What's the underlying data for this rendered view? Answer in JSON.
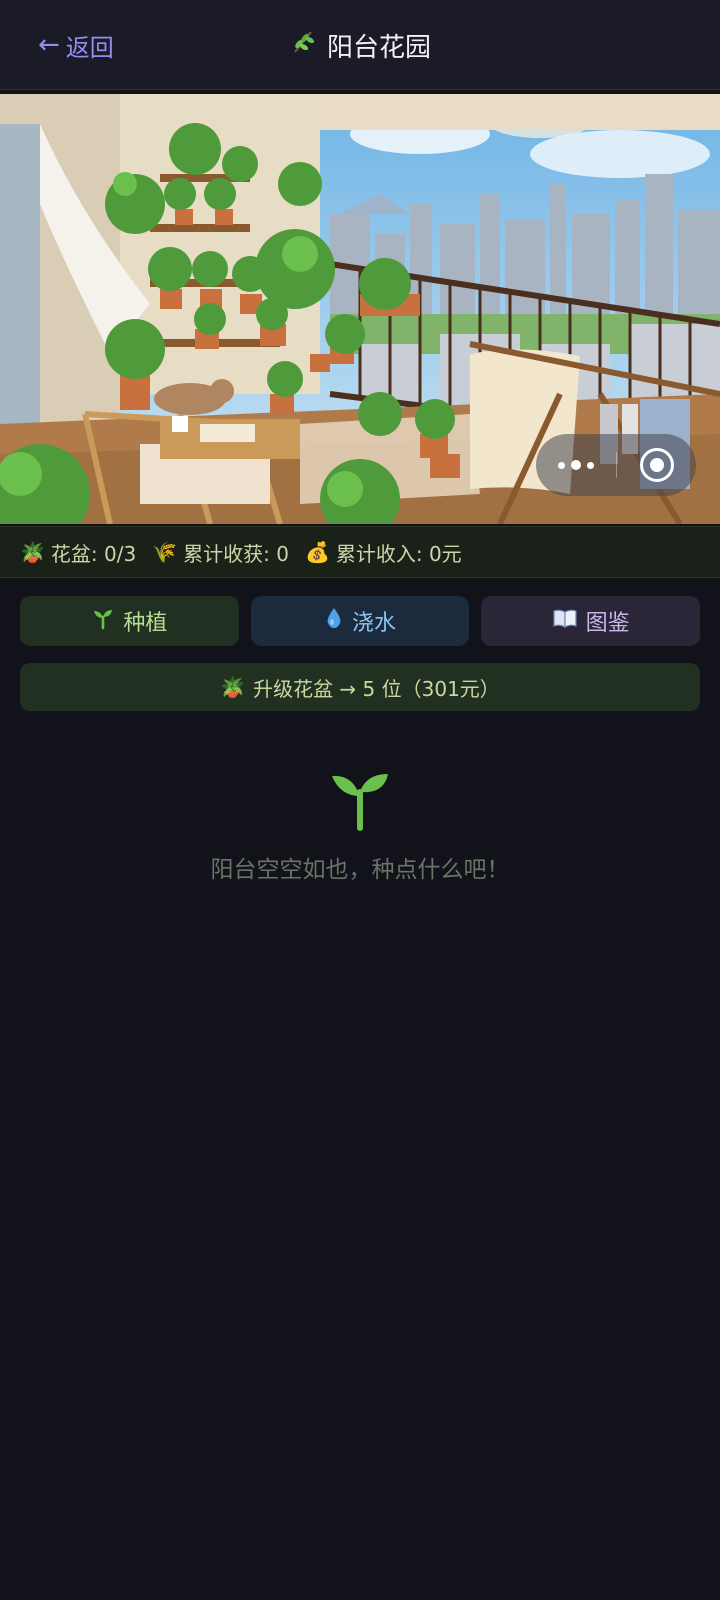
{
  "header": {
    "back_label": "返回",
    "back_icon": "left-arrow-icon",
    "title": "阳台花园",
    "title_icon": "herb-icon"
  },
  "hero": {
    "image_icon": "balcony-garden-illustration"
  },
  "capsule": {
    "more_icon": "more-dots-icon",
    "close_icon": "close-circle-icon"
  },
  "stats": {
    "pots_label": "花盆: 0/3",
    "harvest_label": "累计收获: 0",
    "income_label": "累计收入: 0元",
    "pots_icon": "potted-plant-icon",
    "harvest_icon": "grain-icon",
    "income_icon": "money-bag-icon"
  },
  "actions": {
    "plant_label": "种植",
    "water_label": "浇水",
    "guide_label": "图鉴",
    "plant_icon": "seedling-icon",
    "water_icon": "droplet-icon",
    "guide_icon": "book-icon"
  },
  "upgrade": {
    "label": "升级花盆 → 5 位（301元）",
    "icon": "potted-plant-icon"
  },
  "empty": {
    "message": "阳台空空如也，种点什么吧！",
    "icon": "seedling-icon"
  },
  "colors": {
    "background": "#12121a",
    "header": "#1b1b28",
    "accent_back": "#8f8ff0",
    "plant_btn": "#223021",
    "water_btn": "#1b2a3c",
    "guide_btn": "#2a2638",
    "seedling": "#6bbf4c"
  }
}
